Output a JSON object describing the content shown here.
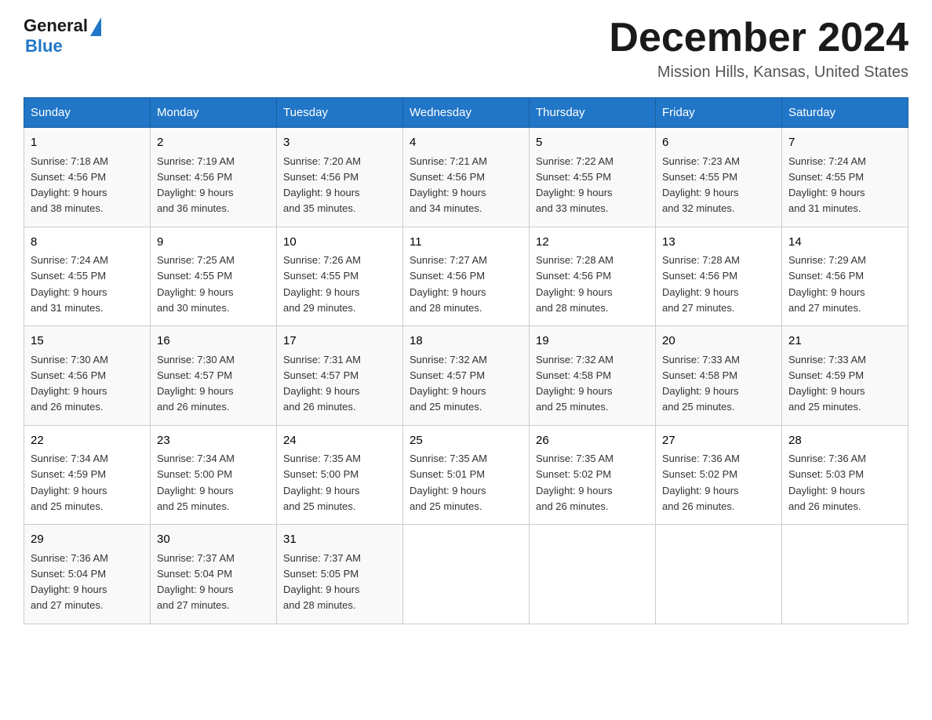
{
  "logo": {
    "general": "General",
    "blue": "Blue"
  },
  "header": {
    "month": "December 2024",
    "location": "Mission Hills, Kansas, United States"
  },
  "weekdays": [
    "Sunday",
    "Monday",
    "Tuesday",
    "Wednesday",
    "Thursday",
    "Friday",
    "Saturday"
  ],
  "weeks": [
    [
      {
        "day": "1",
        "sunrise": "7:18 AM",
        "sunset": "4:56 PM",
        "daylight": "9 hours and 38 minutes."
      },
      {
        "day": "2",
        "sunrise": "7:19 AM",
        "sunset": "4:56 PM",
        "daylight": "9 hours and 36 minutes."
      },
      {
        "day": "3",
        "sunrise": "7:20 AM",
        "sunset": "4:56 PM",
        "daylight": "9 hours and 35 minutes."
      },
      {
        "day": "4",
        "sunrise": "7:21 AM",
        "sunset": "4:56 PM",
        "daylight": "9 hours and 34 minutes."
      },
      {
        "day": "5",
        "sunrise": "7:22 AM",
        "sunset": "4:55 PM",
        "daylight": "9 hours and 33 minutes."
      },
      {
        "day": "6",
        "sunrise": "7:23 AM",
        "sunset": "4:55 PM",
        "daylight": "9 hours and 32 minutes."
      },
      {
        "day": "7",
        "sunrise": "7:24 AM",
        "sunset": "4:55 PM",
        "daylight": "9 hours and 31 minutes."
      }
    ],
    [
      {
        "day": "8",
        "sunrise": "7:24 AM",
        "sunset": "4:55 PM",
        "daylight": "9 hours and 31 minutes."
      },
      {
        "day": "9",
        "sunrise": "7:25 AM",
        "sunset": "4:55 PM",
        "daylight": "9 hours and 30 minutes."
      },
      {
        "day": "10",
        "sunrise": "7:26 AM",
        "sunset": "4:55 PM",
        "daylight": "9 hours and 29 minutes."
      },
      {
        "day": "11",
        "sunrise": "7:27 AM",
        "sunset": "4:56 PM",
        "daylight": "9 hours and 28 minutes."
      },
      {
        "day": "12",
        "sunrise": "7:28 AM",
        "sunset": "4:56 PM",
        "daylight": "9 hours and 28 minutes."
      },
      {
        "day": "13",
        "sunrise": "7:28 AM",
        "sunset": "4:56 PM",
        "daylight": "9 hours and 27 minutes."
      },
      {
        "day": "14",
        "sunrise": "7:29 AM",
        "sunset": "4:56 PM",
        "daylight": "9 hours and 27 minutes."
      }
    ],
    [
      {
        "day": "15",
        "sunrise": "7:30 AM",
        "sunset": "4:56 PM",
        "daylight": "9 hours and 26 minutes."
      },
      {
        "day": "16",
        "sunrise": "7:30 AM",
        "sunset": "4:57 PM",
        "daylight": "9 hours and 26 minutes."
      },
      {
        "day": "17",
        "sunrise": "7:31 AM",
        "sunset": "4:57 PM",
        "daylight": "9 hours and 26 minutes."
      },
      {
        "day": "18",
        "sunrise": "7:32 AM",
        "sunset": "4:57 PM",
        "daylight": "9 hours and 25 minutes."
      },
      {
        "day": "19",
        "sunrise": "7:32 AM",
        "sunset": "4:58 PM",
        "daylight": "9 hours and 25 minutes."
      },
      {
        "day": "20",
        "sunrise": "7:33 AM",
        "sunset": "4:58 PM",
        "daylight": "9 hours and 25 minutes."
      },
      {
        "day": "21",
        "sunrise": "7:33 AM",
        "sunset": "4:59 PM",
        "daylight": "9 hours and 25 minutes."
      }
    ],
    [
      {
        "day": "22",
        "sunrise": "7:34 AM",
        "sunset": "4:59 PM",
        "daylight": "9 hours and 25 minutes."
      },
      {
        "day": "23",
        "sunrise": "7:34 AM",
        "sunset": "5:00 PM",
        "daylight": "9 hours and 25 minutes."
      },
      {
        "day": "24",
        "sunrise": "7:35 AM",
        "sunset": "5:00 PM",
        "daylight": "9 hours and 25 minutes."
      },
      {
        "day": "25",
        "sunrise": "7:35 AM",
        "sunset": "5:01 PM",
        "daylight": "9 hours and 25 minutes."
      },
      {
        "day": "26",
        "sunrise": "7:35 AM",
        "sunset": "5:02 PM",
        "daylight": "9 hours and 26 minutes."
      },
      {
        "day": "27",
        "sunrise": "7:36 AM",
        "sunset": "5:02 PM",
        "daylight": "9 hours and 26 minutes."
      },
      {
        "day": "28",
        "sunrise": "7:36 AM",
        "sunset": "5:03 PM",
        "daylight": "9 hours and 26 minutes."
      }
    ],
    [
      {
        "day": "29",
        "sunrise": "7:36 AM",
        "sunset": "5:04 PM",
        "daylight": "9 hours and 27 minutes."
      },
      {
        "day": "30",
        "sunrise": "7:37 AM",
        "sunset": "5:04 PM",
        "daylight": "9 hours and 27 minutes."
      },
      {
        "day": "31",
        "sunrise": "7:37 AM",
        "sunset": "5:05 PM",
        "daylight": "9 hours and 28 minutes."
      },
      null,
      null,
      null,
      null
    ]
  ],
  "labels": {
    "sunrise": "Sunrise:",
    "sunset": "Sunset:",
    "daylight": "Daylight:"
  }
}
